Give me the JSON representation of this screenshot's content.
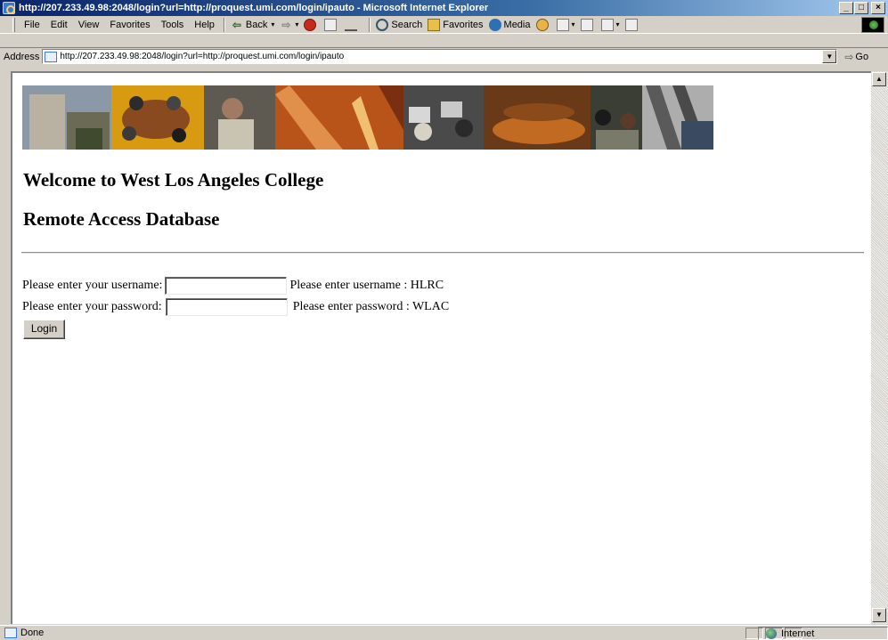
{
  "window": {
    "title": "http://207.233.49.98:2048/login?url=http://proquest.umi.com/login/ipauto - Microsoft Internet Explorer",
    "controls": {
      "minimize": "_",
      "maximize": "□",
      "close": "×"
    }
  },
  "menu": {
    "items": [
      {
        "label": "File"
      },
      {
        "label": "Edit"
      },
      {
        "label": "View"
      },
      {
        "label": "Favorites"
      },
      {
        "label": "Tools"
      },
      {
        "label": "Help"
      }
    ]
  },
  "toolbar": {
    "back_label": "Back",
    "search_label": "Search",
    "favorites_label": "Favorites",
    "media_label": "Media"
  },
  "address": {
    "label": "Address",
    "url": "http://207.233.49.98:2048/login?url=http://proquest.umi.com/login/ipauto",
    "go_label": "Go"
  },
  "page": {
    "heading_1": "Welcome to West Los Angeles College",
    "heading_2": "Remote Access Database",
    "username_label": "Please enter your username:",
    "username_value": "",
    "username_hint": "Please enter username : HLRC",
    "password_label": "Please enter your password:",
    "password_value": "",
    "password_hint": "Please enter password : WLAC",
    "login_button": "Login"
  },
  "status": {
    "text": "Done",
    "zone": "Internet"
  }
}
